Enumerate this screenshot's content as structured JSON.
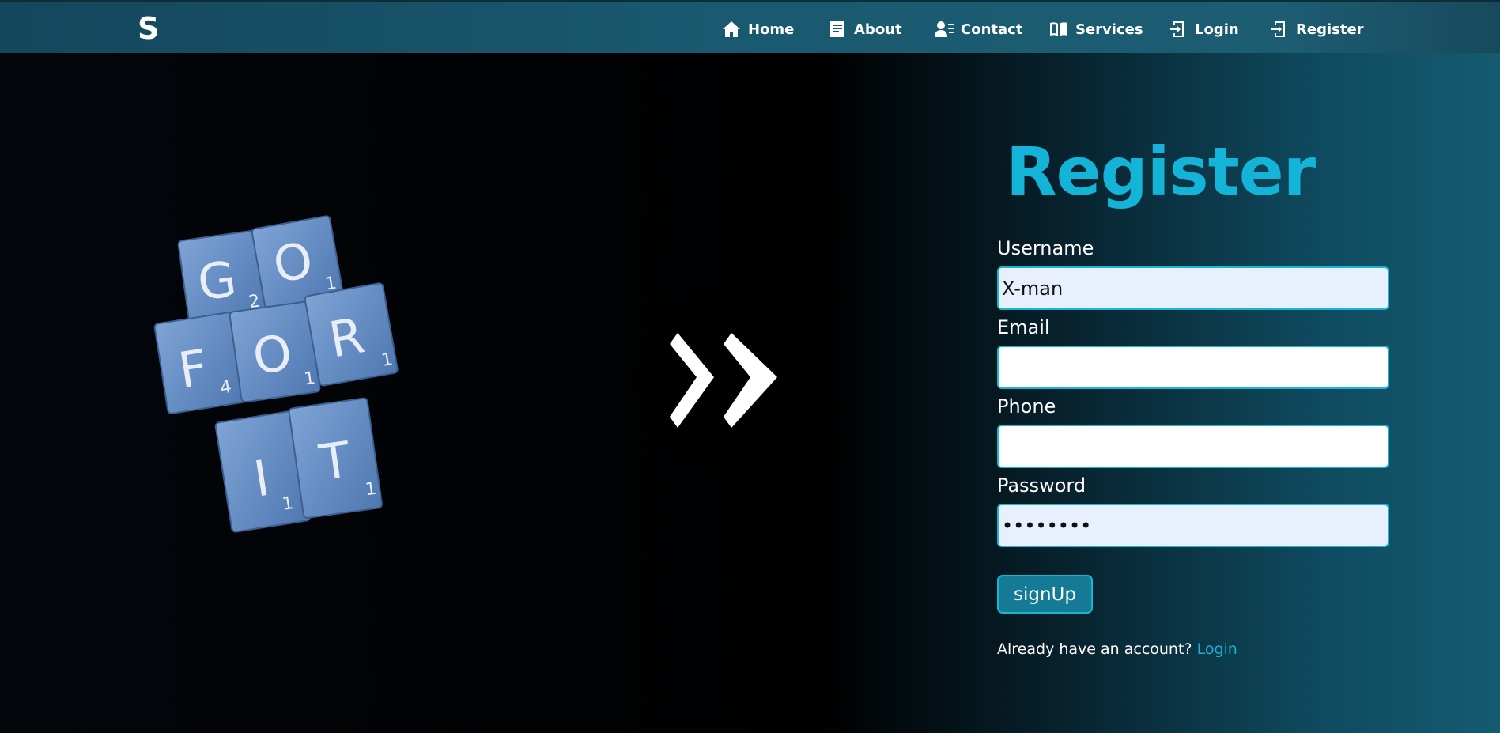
{
  "nav": {
    "brand": "S",
    "links": [
      {
        "label": "Home",
        "icon": "home-icon"
      },
      {
        "label": "About",
        "icon": "document-icon"
      },
      {
        "label": "Contact",
        "icon": "contact-icon"
      },
      {
        "label": "Services",
        "icon": "book-icon"
      },
      {
        "label": "Login",
        "icon": "login-icon"
      },
      {
        "label": "Register",
        "icon": "login-icon"
      }
    ]
  },
  "hero": {
    "tiles": [
      {
        "letter": "G",
        "score": "2"
      },
      {
        "letter": "O",
        "score": "1"
      },
      {
        "letter": "F",
        "score": "4"
      },
      {
        "letter": "O",
        "score": "1"
      },
      {
        "letter": "R",
        "score": "1"
      },
      {
        "letter": "I",
        "score": "1"
      },
      {
        "letter": "T",
        "score": "1"
      }
    ],
    "arrow_icon": "double-chevron-right-icon"
  },
  "form": {
    "title": "Register",
    "username_label": "Username",
    "username_value": "X-man",
    "email_label": "Email",
    "email_value": "",
    "phone_label": "Phone",
    "phone_value": "",
    "password_label": "Password",
    "password_value": "12345678",
    "submit_label": "signUp",
    "account_text": "Already have an account?",
    "login_link": "Login"
  },
  "colors": {
    "accent": "#14b3d8",
    "navbar": "#1a5a70",
    "button": "#157a96",
    "tile": "#6a90c4"
  }
}
